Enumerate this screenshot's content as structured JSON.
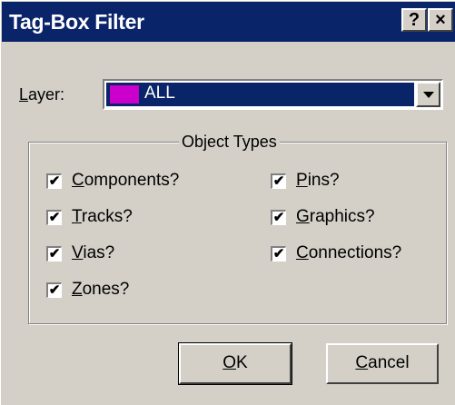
{
  "window": {
    "title": "Tag-Box Filter",
    "help_glyph": "?",
    "close_glyph": "×"
  },
  "layer": {
    "label_mnemonic": "L",
    "label_rest": "ayer:",
    "value": "ALL",
    "swatch_color": "#cc00cc"
  },
  "object_types": {
    "legend": "Object Types",
    "items": [
      {
        "mnemonic": "C",
        "rest": "omponents?",
        "checked": true
      },
      {
        "mnemonic": "T",
        "rest": "racks?",
        "checked": true
      },
      {
        "mnemonic": "V",
        "rest": "ias?",
        "checked": true
      },
      {
        "mnemonic": "Z",
        "rest": "ones?",
        "checked": true
      },
      {
        "mnemonic": "P",
        "rest": "ins?",
        "checked": true
      },
      {
        "mnemonic": "G",
        "rest": "raphics?",
        "checked": true
      },
      {
        "mnemonic": "C",
        "rest": "onnections?",
        "checked": true
      }
    ],
    "check_glyph": "✔"
  },
  "buttons": {
    "ok_mnemonic": "O",
    "ok_rest": "K",
    "cancel_mnemonic": "C",
    "cancel_rest": "ancel"
  },
  "colors": {
    "titlebar": "#0a246a",
    "face": "#d4d0c8",
    "selection": "#0a246a"
  }
}
